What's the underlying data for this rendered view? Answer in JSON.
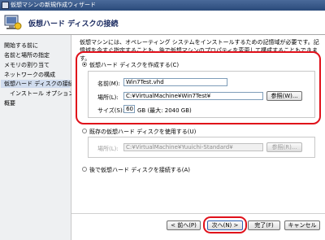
{
  "window": {
    "title": "仮想マシンの新規作成ウィザード"
  },
  "header": {
    "title": "仮想ハード ディスクの接続",
    "icon": "vm-wizard-icon"
  },
  "sidebar": {
    "items": [
      {
        "label": "開始する前に"
      },
      {
        "label": "名前と場所の指定"
      },
      {
        "label": "メモリの割り当て"
      },
      {
        "label": "ネットワークの構成"
      },
      {
        "label": "仮想ハード ディスクの接続"
      },
      {
        "label": "インストール オプション"
      },
      {
        "label": "概要"
      }
    ]
  },
  "main": {
    "description": "仮想マシンには、オペレーティング システムをインストールするための記憶域が必要です。記憶域を今すぐ指定することも、後で仮想マシンのプロパティを変更して構成することもできます。",
    "option_create": {
      "label": "仮想ハード ディスクを作成する(C)",
      "name_label": "名前(M):",
      "name_value": "Win7Test.vhd",
      "location_label": "場所(L):",
      "location_value": "C:¥VirtualMachine¥Win7Test¥",
      "browse_label": "参照(W)...",
      "size_label": "サイズ(S):",
      "size_value": "60",
      "size_unit": "GB (最大: 2040 GB)"
    },
    "option_existing": {
      "label": "既存の仮想ハード ディスクを使用する(U)",
      "location_label": "場所(L):",
      "location_value": "C:¥VirtualMachine¥Yuuichi-Standard¥",
      "browse_label": "参照(R)..."
    },
    "option_later": {
      "label": "後で仮想ハード ディスクを接続する(A)"
    }
  },
  "footer": {
    "back_label": "< 前へ(P)",
    "next_label": "次へ(N) >",
    "finish_label": "完了(F)",
    "cancel_label": "キャンセル"
  },
  "colors": {
    "highlight": "#e0101a",
    "selected_nav": "#d0dcee",
    "header_title": "#1a2a60"
  }
}
